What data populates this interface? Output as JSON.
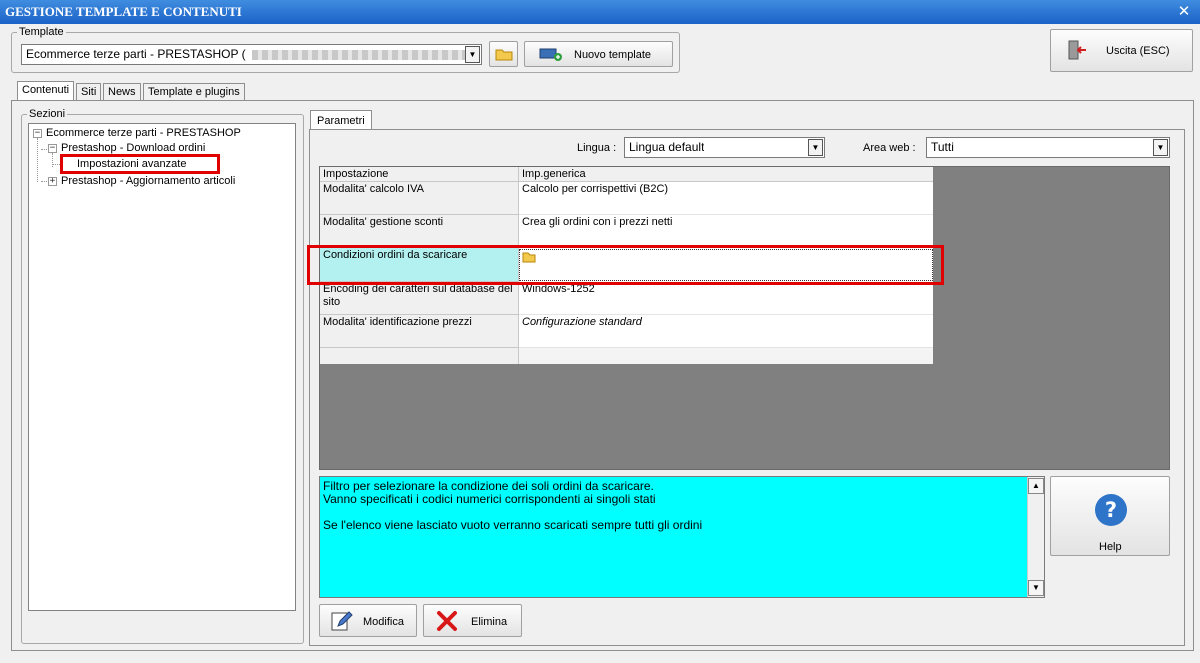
{
  "window": {
    "title": "GESTIONE TEMPLATE E CONTENUTI",
    "close_glyph": "✕"
  },
  "template_group": {
    "label": "Template",
    "selected": "Ecommerce terze parti - PRESTASHOP (",
    "new_button": "Nuovo template"
  },
  "exit_button": "Uscita (ESC)",
  "tabs": [
    "Contenuti",
    "Siti",
    "News",
    "Template e plugins"
  ],
  "sections": {
    "label": "Sezioni",
    "root": "Ecommerce terze parti - PRESTASHOP",
    "child1": "Prestashop - Download ordini",
    "child1_sub": "Impostazioni avanzate",
    "child2": "Prestashop - Aggiornamento articoli"
  },
  "parametri_tab": "Parametri",
  "lingua": {
    "label": "Lingua :",
    "value": "Lingua default"
  },
  "area_web": {
    "label": "Area web :",
    "value": "Tutti"
  },
  "grid": {
    "headers": [
      "Impostazione",
      "Imp.generica"
    ],
    "rows": [
      {
        "name": "Modalita' calcolo IVA",
        "value": "Calcolo per corrispettivi (B2C)"
      },
      {
        "name": "Modalita' gestione sconti",
        "value": "Crea gli ordini con i prezzi netti"
      },
      {
        "name": "Condizioni ordini da scaricare",
        "value": ""
      },
      {
        "name": "Encoding dei caratteri sul database del sito",
        "value": "Windows-1252"
      },
      {
        "name": "Modalita' identificazione prezzi",
        "value": "Configurazione standard"
      }
    ]
  },
  "description": {
    "line1": "Filtro per selezionare la condizione dei soli ordini da scaricare.",
    "line2": "Vanno specificati i codici numerici corrispondenti ai singoli stati",
    "line3": "Se l'elenco viene lasciato vuoto verranno scaricati sempre tutti gli ordini"
  },
  "help": {
    "glyph": "?",
    "label": "Help"
  },
  "modifica_button": "Modifica",
  "elimina_button": "Elimina",
  "colors": {
    "titlebar": "#1c62c8",
    "desc_bg": "#00ffff",
    "highlight": "#e00000",
    "selected_row": "#b3f0f0",
    "grid_bg": "#808080"
  }
}
